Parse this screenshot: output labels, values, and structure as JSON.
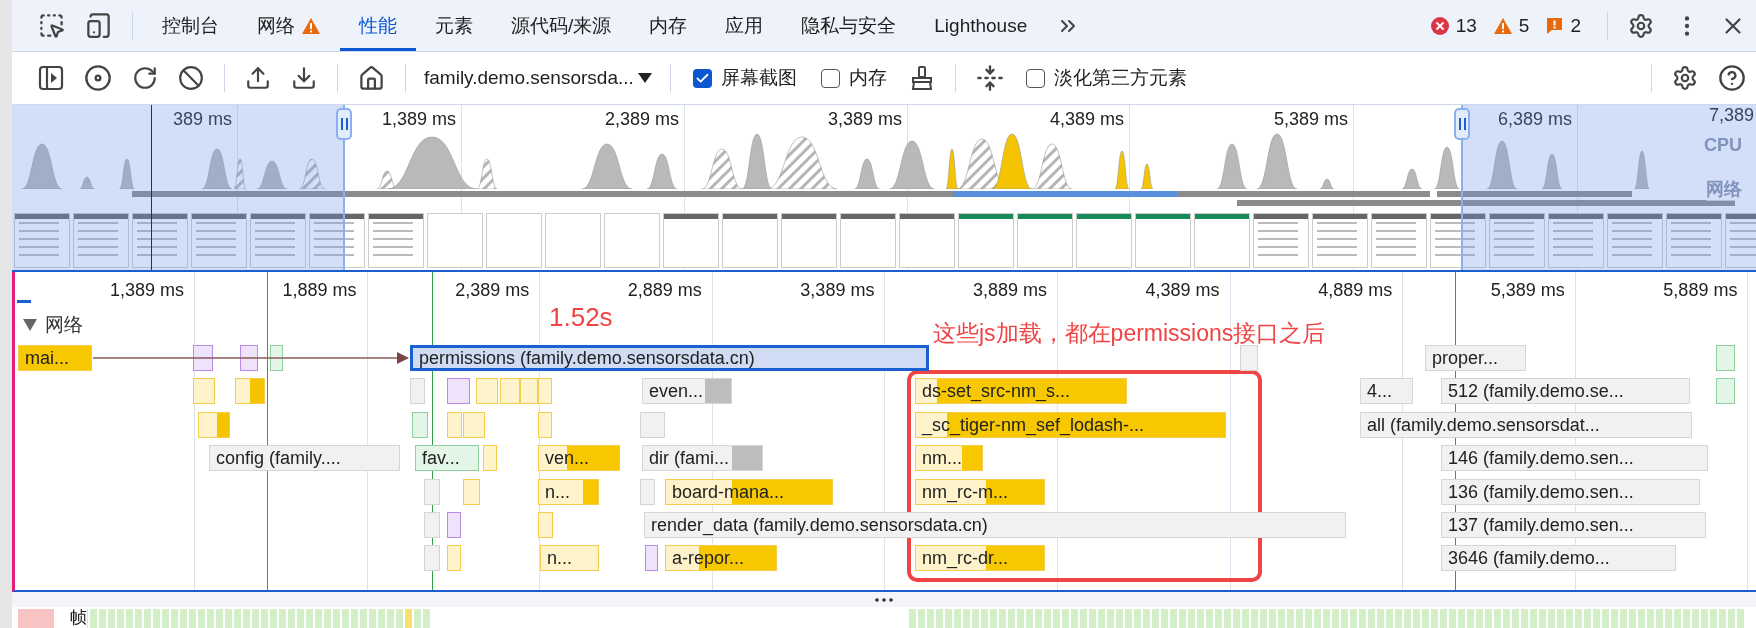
{
  "tabs": [
    {
      "label": "控制台",
      "selected": false,
      "warning": false
    },
    {
      "label": "网络",
      "selected": false,
      "warning": true
    },
    {
      "label": "性能",
      "selected": true,
      "warning": false
    },
    {
      "label": "元素",
      "selected": false,
      "warning": false
    },
    {
      "label": "源代码/来源",
      "selected": false,
      "warning": false
    },
    {
      "label": "内存",
      "selected": false,
      "warning": false
    },
    {
      "label": "应用",
      "selected": false,
      "warning": false
    },
    {
      "label": "隐私与安全",
      "selected": false,
      "warning": false
    },
    {
      "label": "Lighthouse",
      "selected": false,
      "warning": false
    }
  ],
  "counts": {
    "errors": "13",
    "warnings": "5",
    "issues": "2"
  },
  "toolbar": {
    "target": "family.demo.sensorsda...",
    "checkboxes": [
      {
        "label": "屏幕截图",
        "checked": true
      },
      {
        "label": "内存",
        "checked": false
      },
      {
        "label": "淡化第三方元素",
        "checked": false
      }
    ]
  },
  "overview": {
    "ticks": [
      "389 ms",
      "1,389 ms",
      "2,389 ms",
      "3,389 ms",
      "4,389 ms",
      "5,389 ms",
      "6,389 ms",
      "7,389"
    ],
    "tracks": [
      "CPU",
      "网络"
    ]
  },
  "timeline": {
    "ticks": [
      "1,389 ms",
      "1,889 ms",
      "2,389 ms",
      "2,889 ms",
      "3,389 ms",
      "3,889 ms",
      "4,389 ms",
      "4,889 ms",
      "5,389 ms",
      "5,889 ms"
    ],
    "network": {
      "title": "网络",
      "expanded": true,
      "requests": [
        {
          "label": "mai...",
          "kind": "script",
          "selected": false
        },
        {
          "label": "permissions (family.demo.sensorsdata.cn)",
          "kind": "fetch",
          "selected": true
        },
        {
          "label": "proper...",
          "kind": "fetch",
          "selected": false
        },
        {
          "label": "even...",
          "kind": "fetch",
          "selected": false
        },
        {
          "label": "ds-set_src-nm_s...",
          "kind": "script",
          "selected": false
        },
        {
          "label": "4...",
          "kind": "fetch",
          "selected": false
        },
        {
          "label": "512 (family.demo.se...",
          "kind": "fetch",
          "selected": false
        },
        {
          "label": "_sc_tiger-nm_sef_lodash-...",
          "kind": "script",
          "selected": false
        },
        {
          "label": "all (family.demo.sensorsdat...",
          "kind": "fetch",
          "selected": false
        },
        {
          "label": "config (family....",
          "kind": "fetch",
          "selected": false
        },
        {
          "label": "fav...",
          "kind": "image",
          "selected": false
        },
        {
          "label": "ven...",
          "kind": "script",
          "selected": false
        },
        {
          "label": "dir (fami...",
          "kind": "fetch",
          "selected": false
        },
        {
          "label": "nm...",
          "kind": "script",
          "selected": false
        },
        {
          "label": "146 (family.demo.sen...",
          "kind": "fetch",
          "selected": false
        },
        {
          "label": "n...",
          "kind": "script",
          "selected": false
        },
        {
          "label": "board-mana...",
          "kind": "script",
          "selected": false
        },
        {
          "label": "nm_rc-m...",
          "kind": "script",
          "selected": false
        },
        {
          "label": "136 (family.demo.sen...",
          "kind": "fetch",
          "selected": false
        },
        {
          "label": "render_data (family.demo.sensorsdata.cn)",
          "kind": "fetch",
          "selected": false
        },
        {
          "label": "137 (family.demo.sen...",
          "kind": "fetch",
          "selected": false
        },
        {
          "label": "n...",
          "kind": "script",
          "selected": false
        },
        {
          "label": "a-repor...",
          "kind": "script",
          "selected": false
        },
        {
          "label": "nm_rc-dr...",
          "kind": "script",
          "selected": false
        },
        {
          "label": "3646 (family.demo...",
          "kind": "fetch",
          "selected": false
        }
      ]
    },
    "annotations": [
      "1.52s",
      "这些js加载，都在permissions接口之后"
    ]
  },
  "frames": {
    "label": "帧"
  }
}
